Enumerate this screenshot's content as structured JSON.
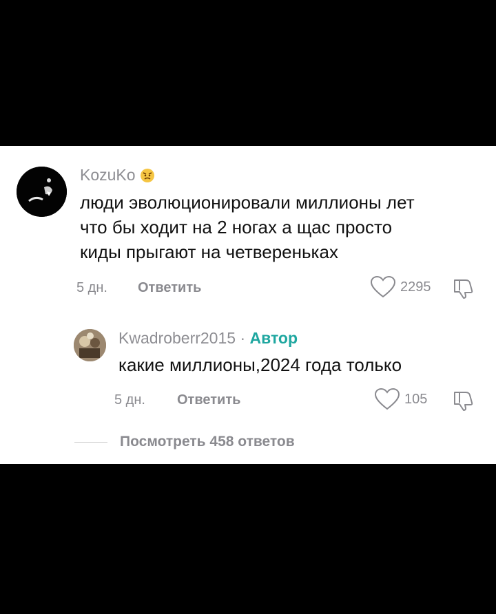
{
  "comment": {
    "username": "KozuKo",
    "emoji_icon": "angry-face-icon",
    "lines": [
      "люди эволюционировали миллионы лет",
      "что бы ходит на 2 ногах а щас просто",
      "киды прыгают на четвереньках"
    ],
    "age": "5 дн.",
    "reply_label": "Ответить",
    "likes": "2295"
  },
  "reply": {
    "username": "Kwadroberr2015",
    "separator": "·",
    "author_badge": "Автор",
    "text": "какие миллионы,2024 года только",
    "age": "5 дн.",
    "reply_label": "Ответить",
    "likes": "105"
  },
  "view_replies": {
    "label": "Посмотреть 458 ответов"
  },
  "colors": {
    "background": "#000000",
    "panel": "#ffffff",
    "author_badge": "#1fa7a0",
    "muted_text": "#8a8a8f",
    "body_text": "#111111"
  }
}
